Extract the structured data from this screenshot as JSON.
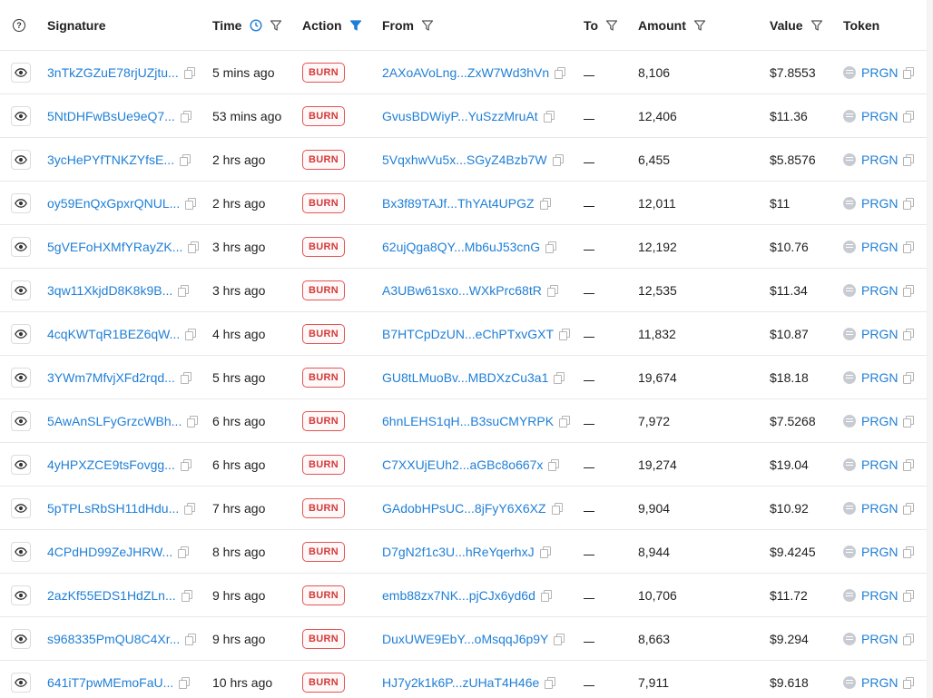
{
  "header": {
    "signature": "Signature",
    "time": "Time",
    "action": "Action",
    "from": "From",
    "to": "To",
    "amount": "Amount",
    "value": "Value",
    "token": "Token"
  },
  "colors": {
    "link": "#1f7fd6",
    "burn_badge": "#d33a3a",
    "active_filter": "#1f7fd6"
  },
  "rows": [
    {
      "signature": "3nTkZGZuE78rjUZjtu...",
      "time": "5 mins ago",
      "action": "BURN",
      "from": "2AXoAVoLng...ZxW7Wd3hVn",
      "to": "",
      "amount": "8,106",
      "value": "$7.8553",
      "token": "PRGN"
    },
    {
      "signature": "5NtDHFwBsUe9eQ7...",
      "time": "53 mins ago",
      "action": "BURN",
      "from": "GvusBDWiyP...YuSzzMruAt",
      "to": "",
      "amount": "12,406",
      "value": "$11.36",
      "token": "PRGN"
    },
    {
      "signature": "3ycHePYfTNKZYfsE...",
      "time": "2 hrs ago",
      "action": "BURN",
      "from": "5VqxhwVu5x...SGyZ4Bzb7W",
      "to": "",
      "amount": "6,455",
      "value": "$5.8576",
      "token": "PRGN"
    },
    {
      "signature": "oy59EnQxGpxrQNUL...",
      "time": "2 hrs ago",
      "action": "BURN",
      "from": "Bx3f89TAJf...ThYAt4UPGZ",
      "to": "",
      "amount": "12,011",
      "value": "$11",
      "token": "PRGN"
    },
    {
      "signature": "5gVEFoHXMfYRayZK...",
      "time": "3 hrs ago",
      "action": "BURN",
      "from": "62ujQga8QY...Mb6uJ53cnG",
      "to": "",
      "amount": "12,192",
      "value": "$10.76",
      "token": "PRGN"
    },
    {
      "signature": "3qw11XkjdD8K8k9B...",
      "time": "3 hrs ago",
      "action": "BURN",
      "from": "A3UBw61sxo...WXkPrc68tR",
      "to": "",
      "amount": "12,535",
      "value": "$11.34",
      "token": "PRGN"
    },
    {
      "signature": "4cqKWTqR1BEZ6qW...",
      "time": "4 hrs ago",
      "action": "BURN",
      "from": "B7HTCpDzUN...eChPTxvGXT",
      "to": "",
      "amount": "11,832",
      "value": "$10.87",
      "token": "PRGN"
    },
    {
      "signature": "3YWm7MfvjXFd2rqd...",
      "time": "5 hrs ago",
      "action": "BURN",
      "from": "GU8tLMuoBv...MBDXzCu3a1",
      "to": "",
      "amount": "19,674",
      "value": "$18.18",
      "token": "PRGN"
    },
    {
      "signature": "5AwAnSLFyGrzcWBh...",
      "time": "6 hrs ago",
      "action": "BURN",
      "from": "6hnLEHS1qH...B3suCMYRPK",
      "to": "",
      "amount": "7,972",
      "value": "$7.5268",
      "token": "PRGN"
    },
    {
      "signature": "4yHPXZCE9tsFovgg...",
      "time": "6 hrs ago",
      "action": "BURN",
      "from": "C7XXUjEUh2...aGBc8o667x",
      "to": "",
      "amount": "19,274",
      "value": "$19.04",
      "token": "PRGN"
    },
    {
      "signature": "5pTPLsRbSH11dHdu...",
      "time": "7 hrs ago",
      "action": "BURN",
      "from": "GAdobHPsUC...8jFyY6X6XZ",
      "to": "",
      "amount": "9,904",
      "value": "$10.92",
      "token": "PRGN"
    },
    {
      "signature": "4CPdHD99ZeJHRW...",
      "time": "8 hrs ago",
      "action": "BURN",
      "from": "D7gN2f1c3U...hReYqerhxJ",
      "to": "",
      "amount": "8,944",
      "value": "$9.4245",
      "token": "PRGN"
    },
    {
      "signature": "2azKf55EDS1HdZLn...",
      "time": "9 hrs ago",
      "action": "BURN",
      "from": "emb88zx7NK...pjCJx6yd6d",
      "to": "",
      "amount": "10,706",
      "value": "$11.72",
      "token": "PRGN"
    },
    {
      "signature": "s968335PmQU8C4Xr...",
      "time": "9 hrs ago",
      "action": "BURN",
      "from": "DuxUWE9EbY...oMsqqJ6p9Y",
      "to": "",
      "amount": "8,663",
      "value": "$9.294",
      "token": "PRGN"
    },
    {
      "signature": "641iT7pwMEmoFaU...",
      "time": "10 hrs ago",
      "action": "BURN",
      "from": "HJ7y2k1k6P...zUHaT4H46e",
      "to": "",
      "amount": "7,911",
      "value": "$9.618",
      "token": "PRGN"
    }
  ]
}
